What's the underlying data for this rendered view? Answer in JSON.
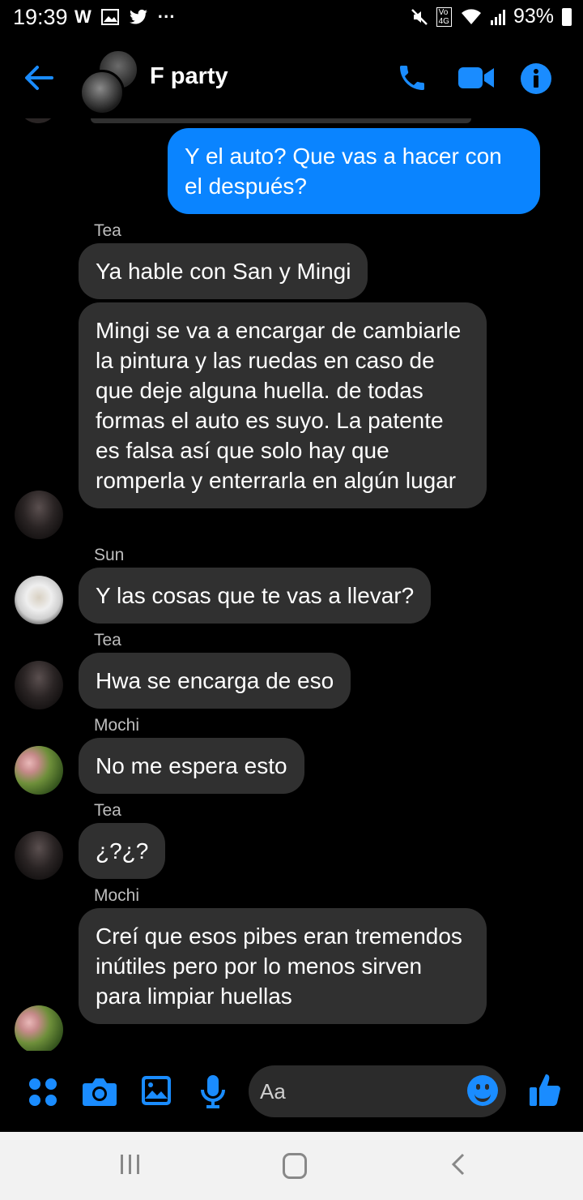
{
  "status_bar": {
    "time": "19:39",
    "notification_icons": [
      "whatsapp-icon",
      "gallery-icon",
      "twitter-icon",
      "more-dots-icon"
    ],
    "status_icons": [
      "mute-icon",
      "volte-4g-icon",
      "wifi-icon",
      "signal-icon"
    ],
    "network": "4G",
    "volte_label": "Vo",
    "battery": "93%"
  },
  "header": {
    "title": "F party",
    "actions": [
      "back-arrow-icon",
      "phone-icon",
      "video-icon",
      "info-icon"
    ]
  },
  "messages": [
    {
      "from": "me",
      "text": "Y el auto? Que vas a hacer con el después?"
    },
    {
      "sender": "Tea",
      "text": "Ya hable con San y Mingi"
    },
    {
      "sender": "Tea",
      "text": "Mingi se va a encargar de cambiarle la pintura y las ruedas en caso de que deje alguna huella. de todas formas el auto es suyo. La patente es falsa así que solo hay que romperla y enterrarla en algún lugar"
    },
    {
      "sender": "Sun",
      "text": "Y las cosas que te vas a llevar?"
    },
    {
      "sender": "Tea",
      "text": "Hwa se encarga de eso"
    },
    {
      "sender": "Mochi",
      "text": "No me espera esto"
    },
    {
      "sender": "Tea",
      "text": "¿?¿?"
    },
    {
      "sender": "Mochi",
      "text": "Creí que esos pibes eran tremendos inútiles pero por lo menos sirven para limpiar huellas"
    }
  ],
  "composer": {
    "placeholder": "Aa",
    "icons": [
      "apps-icon",
      "camera-icon",
      "image-icon",
      "microphone-icon",
      "emoji-icon",
      "like-icon"
    ]
  },
  "colors": {
    "accent": "#0a84ff",
    "incoming_bubble": "#303030",
    "background": "#000000"
  }
}
